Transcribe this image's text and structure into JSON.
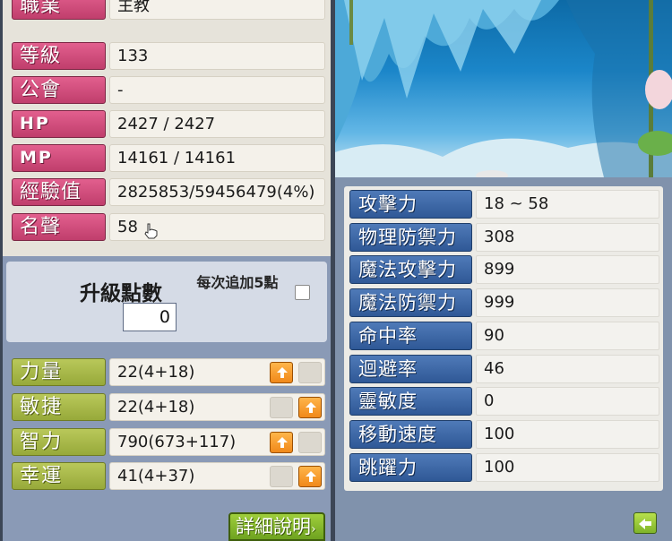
{
  "character_info": [
    {
      "label": "職業",
      "value": "主教"
    },
    {
      "label": "等級",
      "value": "133"
    },
    {
      "label": "公會",
      "value": "-"
    },
    {
      "label": "HP",
      "value": "2427 / 2427"
    },
    {
      "label": "MP",
      "value": "14161 / 14161"
    },
    {
      "label": "經驗值",
      "value": "2825853/59456479(4%)"
    },
    {
      "label": "名聲",
      "value": "58"
    }
  ],
  "ability_points": {
    "label": "升級點數",
    "value": "0",
    "auto_assign_label": "每次追加5點"
  },
  "stats": [
    {
      "label": "力量",
      "value": "22(4+18)",
      "up_enabled": true
    },
    {
      "label": "敏捷",
      "value": "22(4+18)",
      "up_enabled": true
    },
    {
      "label": "智力",
      "value": "790(673+117)",
      "up_enabled": true
    },
    {
      "label": "幸運",
      "value": "41(4+37)",
      "up_enabled": true
    }
  ],
  "detail_button_label": "詳細說明",
  "detail_stats": [
    {
      "label": "攻擊力",
      "value": "18 ~ 58"
    },
    {
      "label": "物理防禦力",
      "value": "308"
    },
    {
      "label": "魔法攻擊力",
      "value": "899"
    },
    {
      "label": "魔法防禦力",
      "value": "999"
    },
    {
      "label": "命中率",
      "value": "90"
    },
    {
      "label": "迴避率",
      "value": "46"
    },
    {
      "label": "靈敏度",
      "value": "0"
    },
    {
      "label": "移動速度",
      "value": "100"
    },
    {
      "label": "跳躍力",
      "value": "100"
    }
  ],
  "colors": {
    "info_label": "#c03e6c",
    "stat_label": "#97a93a",
    "detail_label": "#2f5896",
    "up_button": "#f0891a"
  }
}
